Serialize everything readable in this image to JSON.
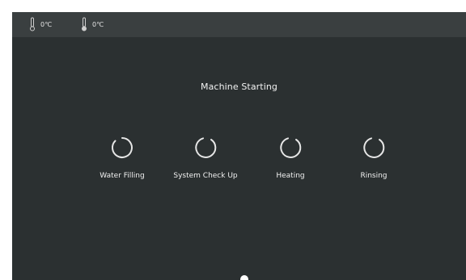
{
  "status_bar": {
    "temperatures": [
      {
        "icon": "thermometer-icon",
        "value": "0℃"
      },
      {
        "icon": "thermometer-icon",
        "value": "0℃"
      }
    ]
  },
  "main": {
    "title": "Machine Starting",
    "steps": [
      {
        "label": "Water Filling",
        "icon": "loading-spinner-icon"
      },
      {
        "label": "System Check Up",
        "icon": "loading-spinner-icon"
      },
      {
        "label": "Heating",
        "icon": "loading-spinner-icon"
      },
      {
        "label": "Rinsing",
        "icon": "loading-spinner-icon"
      }
    ]
  },
  "colors": {
    "background": "#2b3031",
    "status_bar": "#3a3f40",
    "text": "#f0f0f0",
    "spinner": "#e6e6e6"
  }
}
